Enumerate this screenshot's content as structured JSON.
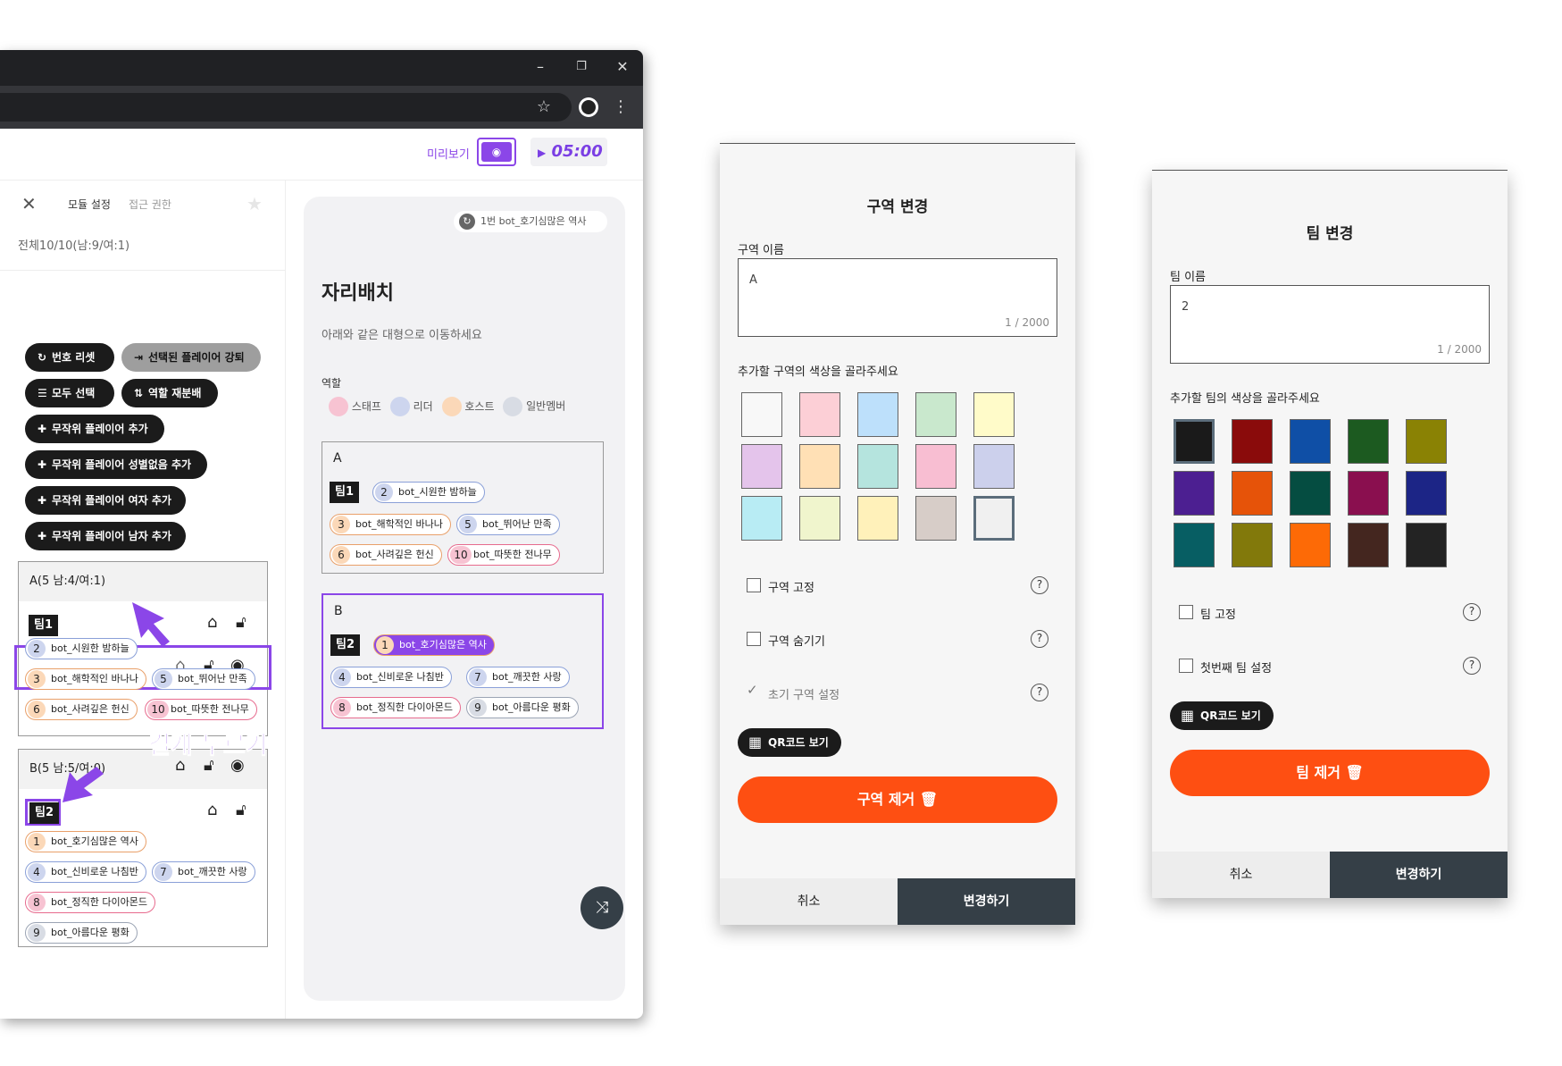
{
  "browser": {
    "min_icon": "–",
    "restore_icon": "❐",
    "close_icon": "✕",
    "star_icon": "☆",
    "menu_icon": "⋮"
  },
  "header": {
    "preview_label": "미리보기",
    "timer": "05:00"
  },
  "left_panel": {
    "tabs": [
      "모듈 설정",
      "접근 권한"
    ],
    "summary": "전체10/10(남:9/여:1)",
    "buttons": {
      "reset_numbers": "번호 리셋",
      "kick_selected": "선택된 플레이어 강퇴",
      "select_all": "모두 선택",
      "redistribute_roles": "역할 재분배",
      "add_random": "무작위 플레이어 추가",
      "add_random_genderless": "무작위 플레이어 성별없음 추가",
      "add_random_female": "무작위 플레이어 여자 추가",
      "add_random_male": "무작위 플레이어 남자 추가"
    },
    "zone_a": {
      "header": "A(5 남:4/여:1)",
      "team": "팀1",
      "players": [
        {
          "num": "2",
          "name": "bot_시원한 밤하늘"
        },
        {
          "num": "3",
          "name": "bot_해학적인 바나나"
        },
        {
          "num": "5",
          "name": "bot_뛰어난 만족"
        },
        {
          "num": "6",
          "name": "bot_사려깊은 헌신"
        },
        {
          "num": "10",
          "name": "bot_따뜻한 전나무"
        }
      ]
    },
    "zone_b": {
      "header": "B(5 남:5/여:0)",
      "team": "팀2",
      "players": [
        {
          "num": "1",
          "name": "bot_호기심많은 역사"
        },
        {
          "num": "4",
          "name": "bot_신비로운 나침반"
        },
        {
          "num": "7",
          "name": "bot_깨끗한 사랑"
        },
        {
          "num": "8",
          "name": "bot_정직한 다이아몬드"
        },
        {
          "num": "9",
          "name": "bot_아름다운 평화"
        }
      ]
    },
    "annotation": "길게 누르기"
  },
  "center": {
    "current_player": "1번 bot_호기심많은 역사",
    "title": "자리배치",
    "subtitle": "아래와 같은 대형으로 이동하세요",
    "roles_label": "역할",
    "roles": [
      {
        "name": "스태프",
        "color": "#f7c3d2"
      },
      {
        "name": "리더",
        "color": "#cdd5ee"
      },
      {
        "name": "호스트",
        "color": "#fbd8b8"
      },
      {
        "name": "일반멤버",
        "color": "#d8dce4"
      }
    ],
    "zone_a": {
      "label": "A",
      "team": "팀1",
      "players": [
        {
          "num": "2",
          "name": "bot_시원한 밤하늘"
        },
        {
          "num": "3",
          "name": "bot_해학적인 바나나"
        },
        {
          "num": "5",
          "name": "bot_뛰어난 만족"
        },
        {
          "num": "6",
          "name": "bot_사려깊은 헌신"
        },
        {
          "num": "10",
          "name": "bot_따뜻한 전나무"
        }
      ]
    },
    "zone_b": {
      "label": "B",
      "team": "팀2",
      "players": [
        {
          "num": "1",
          "name": "bot_호기심많은 역사"
        },
        {
          "num": "4",
          "name": "bot_신비로운 나침반"
        },
        {
          "num": "7",
          "name": "bot_깨끗한 사랑"
        },
        {
          "num": "8",
          "name": "bot_정직한 다이아몬드"
        },
        {
          "num": "9",
          "name": "bot_아름다운 평화"
        }
      ]
    }
  },
  "zone_dialog": {
    "title": "구역 변경",
    "name_label": "구역 이름",
    "name_value": "A",
    "counter": "1 / 2000",
    "color_label": "추가할 구역의 색상을 골라주세요",
    "colors": [
      "#f8f8f8",
      "#fccfd6",
      "#bde0fb",
      "#c9e8cd",
      "#fffbc9",
      "#e4c4eb",
      "#ffe0b5",
      "#b5e4de",
      "#f8bed2",
      "#ccd0ec",
      "#b8ecf4",
      "#f0f5cd",
      "#fff1ba",
      "#d7cdc8",
      "#f0f0f0"
    ],
    "options": [
      {
        "label": "구역 고정",
        "checked": false
      },
      {
        "label": "구역 숨기기",
        "checked": false
      },
      {
        "label": "초기 구역 설정",
        "checked": true
      }
    ],
    "qr_label": "QR코드 보기",
    "remove_label": "구역 제거",
    "cancel_label": "취소",
    "confirm_label": "변경하기"
  },
  "team_dialog": {
    "title": "팀 변경",
    "name_label": "팀 이름",
    "name_value": "2",
    "counter": "1 / 2000",
    "color_label": "추가할 팀의 색상을 골라주세요",
    "colors": [
      "#1a1a1a",
      "#8a0b0b",
      "#0f4fa6",
      "#1c5a20",
      "#8a8204",
      "#4c1f91",
      "#e65309",
      "#054d41",
      "#8a0f4f",
      "#1c2586",
      "#075e63",
      "#82790b",
      "#fd6a06",
      "#44261f",
      "#232323"
    ],
    "options": [
      {
        "label": "팀 고정",
        "checked": false
      },
      {
        "label": "첫번째 팀 설정",
        "checked": false
      }
    ],
    "qr_label": "QR코드 보기",
    "remove_label": "팀 제거",
    "cancel_label": "취소",
    "confirm_label": "변경하기"
  }
}
